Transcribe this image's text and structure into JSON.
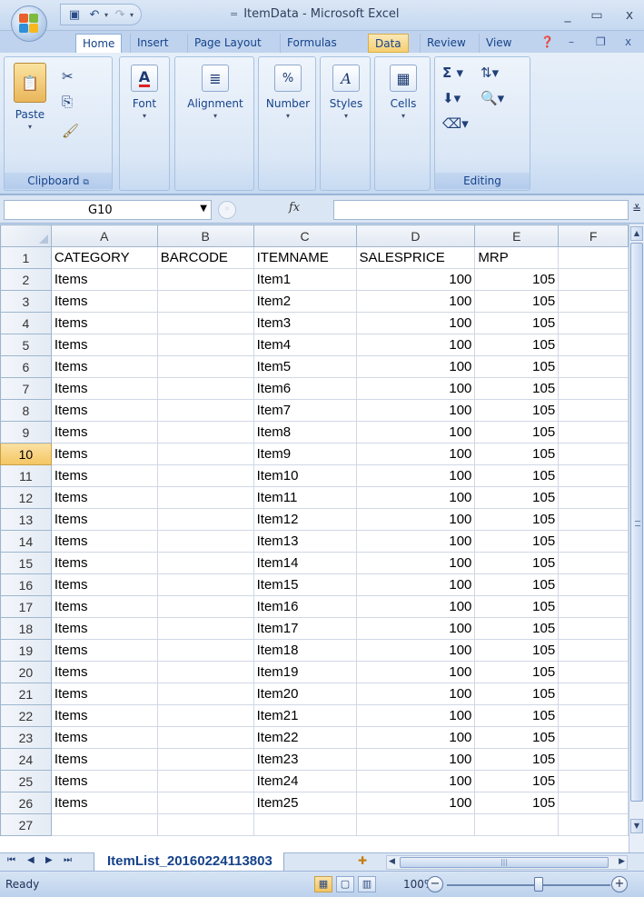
{
  "window": {
    "title": "ItemData - Microsoft Excel",
    "title_sep": "="
  },
  "ribbon": {
    "tabs": [
      "Home",
      "Insert",
      "Page Layout",
      "Formulas",
      "Data",
      "Review",
      "View"
    ],
    "groups": {
      "clipboard": {
        "label": "Clipboard",
        "paste": "Paste"
      },
      "font": {
        "label": "Font"
      },
      "alignment": {
        "label": "Alignment"
      },
      "number": {
        "label": "Number"
      },
      "styles": {
        "label": "Styles"
      },
      "cells": {
        "label": "Cells"
      },
      "editing": {
        "label": "Editing"
      }
    }
  },
  "formula_bar": {
    "name_box": "G10",
    "fx": "fx",
    "content": ""
  },
  "sheet": {
    "columns": [
      "A",
      "B",
      "C",
      "D",
      "E",
      "F"
    ],
    "selected_row": "10",
    "rows": [
      {
        "n": "1",
        "a": "CATEGORY",
        "b": "BARCODE",
        "c": "ITEMNAME",
        "d": "SALESPRICE",
        "e": "MRP"
      },
      {
        "n": "2",
        "a": "Items",
        "b": "",
        "c": "Item1",
        "d": "100",
        "e": "105"
      },
      {
        "n": "3",
        "a": "Items",
        "b": "",
        "c": "Item2",
        "d": "100",
        "e": "105"
      },
      {
        "n": "4",
        "a": "Items",
        "b": "",
        "c": "Item3",
        "d": "100",
        "e": "105"
      },
      {
        "n": "5",
        "a": "Items",
        "b": "",
        "c": "Item4",
        "d": "100",
        "e": "105"
      },
      {
        "n": "6",
        "a": "Items",
        "b": "",
        "c": "Item5",
        "d": "100",
        "e": "105"
      },
      {
        "n": "7",
        "a": "Items",
        "b": "",
        "c": "Item6",
        "d": "100",
        "e": "105"
      },
      {
        "n": "8",
        "a": "Items",
        "b": "",
        "c": "Item7",
        "d": "100",
        "e": "105"
      },
      {
        "n": "9",
        "a": "Items",
        "b": "",
        "c": "Item8",
        "d": "100",
        "e": "105"
      },
      {
        "n": "10",
        "a": "Items",
        "b": "",
        "c": "Item9",
        "d": "100",
        "e": "105"
      },
      {
        "n": "11",
        "a": "Items",
        "b": "",
        "c": "Item10",
        "d": "100",
        "e": "105"
      },
      {
        "n": "12",
        "a": "Items",
        "b": "",
        "c": "Item11",
        "d": "100",
        "e": "105"
      },
      {
        "n": "13",
        "a": "Items",
        "b": "",
        "c": "Item12",
        "d": "100",
        "e": "105"
      },
      {
        "n": "14",
        "a": "Items",
        "b": "",
        "c": "Item13",
        "d": "100",
        "e": "105"
      },
      {
        "n": "15",
        "a": "Items",
        "b": "",
        "c": "Item14",
        "d": "100",
        "e": "105"
      },
      {
        "n": "16",
        "a": "Items",
        "b": "",
        "c": "Item15",
        "d": "100",
        "e": "105"
      },
      {
        "n": "17",
        "a": "Items",
        "b": "",
        "c": "Item16",
        "d": "100",
        "e": "105"
      },
      {
        "n": "18",
        "a": "Items",
        "b": "",
        "c": "Item17",
        "d": "100",
        "e": "105"
      },
      {
        "n": "19",
        "a": "Items",
        "b": "",
        "c": "Item18",
        "d": "100",
        "e": "105"
      },
      {
        "n": "20",
        "a": "Items",
        "b": "",
        "c": "Item19",
        "d": "100",
        "e": "105"
      },
      {
        "n": "21",
        "a": "Items",
        "b": "",
        "c": "Item20",
        "d": "100",
        "e": "105"
      },
      {
        "n": "22",
        "a": "Items",
        "b": "",
        "c": "Item21",
        "d": "100",
        "e": "105"
      },
      {
        "n": "23",
        "a": "Items",
        "b": "",
        "c": "Item22",
        "d": "100",
        "e": "105"
      },
      {
        "n": "24",
        "a": "Items",
        "b": "",
        "c": "Item23",
        "d": "100",
        "e": "105"
      },
      {
        "n": "25",
        "a": "Items",
        "b": "",
        "c": "Item24",
        "d": "100",
        "e": "105"
      },
      {
        "n": "26",
        "a": "Items",
        "b": "",
        "c": "Item25",
        "d": "100",
        "e": "105"
      },
      {
        "n": "27",
        "a": "",
        "b": "",
        "c": "",
        "d": "",
        "e": ""
      }
    ]
  },
  "sheet_tabs": {
    "active": "ItemList_20160224113803"
  },
  "status": {
    "text": "Ready",
    "zoom": "100%"
  },
  "colors": {
    "accent": "#15428b",
    "selected_row_header": "#f4c561"
  }
}
